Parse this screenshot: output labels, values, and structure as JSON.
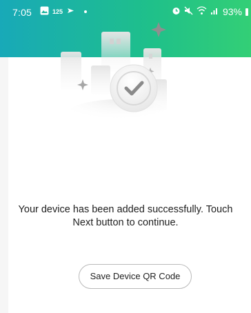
{
  "status_bar": {
    "time": "7:05",
    "notification_badge": "125",
    "battery_percent": "93%"
  },
  "message": {
    "line1": "Your device has been added successfully. Touch",
    "line2": "Next button to continue."
  },
  "buttons": {
    "save_qr_label": "Save Device QR Code"
  },
  "colors": {
    "header_gradient_start": "#18a9b8",
    "header_gradient_end": "#33cf76",
    "check_color": "#8a8a8a"
  },
  "icons": {
    "status_left": [
      "gallery-icon",
      "notification-count-badge",
      "location-icon",
      "dot-icon"
    ],
    "status_right": [
      "alarm-icon",
      "mute-icon",
      "wifi-icon",
      "signal-icon",
      "battery-icon"
    ],
    "illustration": "success-checkmark-icon"
  }
}
